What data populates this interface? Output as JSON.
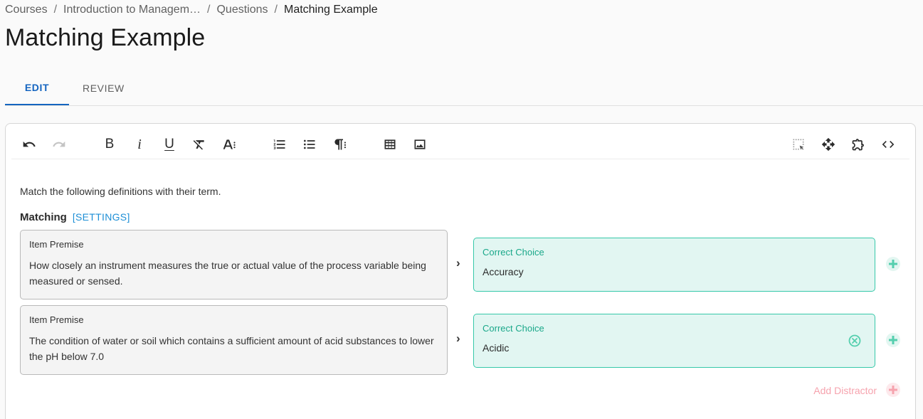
{
  "breadcrumb": {
    "items": [
      "Courses",
      "Introduction to Managem…",
      "Questions",
      "Matching Example"
    ],
    "separator": "/"
  },
  "page": {
    "title": "Matching Example"
  },
  "tabs": [
    {
      "label": "EDIT",
      "active": true
    },
    {
      "label": "REVIEW",
      "active": false
    }
  ],
  "toolbar": {
    "buttons": [
      "undo",
      "redo",
      "bold",
      "italic",
      "underline",
      "clear-format",
      "font-size",
      "ordered-list",
      "bulleted-list",
      "paragraph-format",
      "table",
      "image",
      "select-all",
      "move",
      "extension",
      "source-code"
    ],
    "bold_glyph": "B",
    "italic_glyph": "i",
    "underline_glyph": "U"
  },
  "content": {
    "instructions": "Match the following definitions with their term.",
    "matching_title": "Matching",
    "settings_label": "[SETTINGS]",
    "pairs": [
      {
        "premise_label": "Item Premise",
        "premise_text": "How closely an instrument measures the true or actual value of the process variable being measured or sensed.",
        "choice_label": "Correct Choice",
        "choice_value": "Accuracy"
      },
      {
        "premise_label": "Item Premise",
        "premise_text": "The condition of water or soil which contains a sufficient amount of acid substances to lower the pH below 7.0",
        "choice_label": "Correct Choice",
        "choice_value": "Acidic"
      }
    ],
    "add_distractor_label": "Add Distractor"
  },
  "colors": {
    "accent": "#1565c0",
    "settings_link": "#1e8fd6",
    "choice_bg": "#e2f6f2",
    "choice_border": "#36c8a9",
    "choice_label": "#1aa88a",
    "add_green": "#55cfae",
    "add_red": "#f6a3ae"
  }
}
